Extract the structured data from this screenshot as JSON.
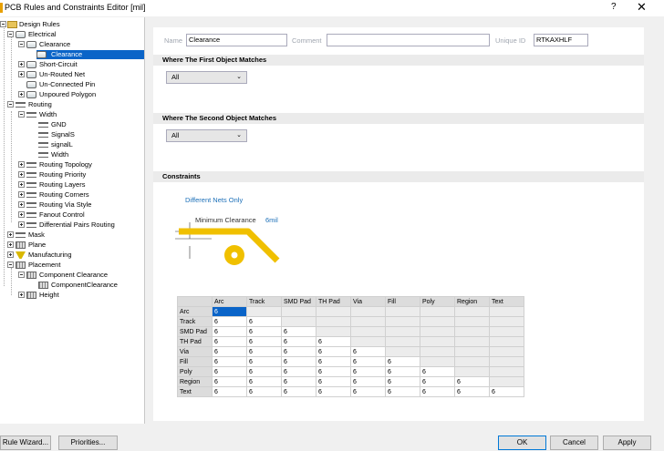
{
  "window": {
    "title": "PCB Rules and Constraints Editor [mil]",
    "help": "?",
    "close": "✕"
  },
  "tree": {
    "design_rules": "Design Rules",
    "electrical": "Electrical",
    "clearance_group": "Clearance",
    "clearance_rule": "Clearance",
    "short_circuit": "Short-Circuit",
    "unrouted_net": "Un-Routed Net",
    "unconnected_pin": "Un-Connected Pin",
    "unpoured_polygon": "Unpoured Polygon",
    "routing": "Routing",
    "width_group": "Width",
    "width_items": [
      "GND",
      "SignalS",
      "signalL",
      "Width"
    ],
    "routing_topology": "Routing Topology",
    "routing_priority": "Routing Priority",
    "routing_layers": "Routing Layers",
    "routing_corners": "Routing Corners",
    "routing_via_style": "Routing Via Style",
    "fanout_control": "Fanout Control",
    "diff_pairs": "Differential Pairs Routing",
    "mask": "Mask",
    "plane": "Plane",
    "manufacturing": "Manufacturing",
    "placement": "Placement",
    "component_clearance_group": "Component Clearance",
    "component_clearance_rule": "ComponentClearance",
    "height": "Height"
  },
  "form": {
    "name_label": "Name",
    "name_value": "Clearance",
    "comment_label": "Comment",
    "comment_value": "",
    "uid_label": "Unique ID",
    "uid_value": "RTKAXHLF"
  },
  "first_match": {
    "heading": "Where The First Object Matches",
    "value": "All"
  },
  "second_match": {
    "heading": "Where The Second Object Matches",
    "value": "All"
  },
  "constraints": {
    "heading": "Constraints",
    "net_scope": "Different Nets Only",
    "min_clearance_label": "Minimum Clearance",
    "min_clearance_value": "6mil",
    "columns": [
      "Arc",
      "Track",
      "SMD Pad",
      "TH Pad",
      "Via",
      "Fill",
      "Poly",
      "Region",
      "Text"
    ],
    "rows": [
      {
        "label": "Arc",
        "values": [
          "6"
        ]
      },
      {
        "label": "Track",
        "values": [
          "6",
          "6"
        ]
      },
      {
        "label": "SMD Pad",
        "values": [
          "6",
          "6",
          "6"
        ]
      },
      {
        "label": "TH Pad",
        "values": [
          "6",
          "6",
          "6",
          "6"
        ]
      },
      {
        "label": "Via",
        "values": [
          "6",
          "6",
          "6",
          "6",
          "6"
        ]
      },
      {
        "label": "Fill",
        "values": [
          "6",
          "6",
          "6",
          "6",
          "6",
          "6"
        ]
      },
      {
        "label": "Poly",
        "values": [
          "6",
          "6",
          "6",
          "6",
          "6",
          "6",
          "6"
        ]
      },
      {
        "label": "Region",
        "values": [
          "6",
          "6",
          "6",
          "6",
          "6",
          "6",
          "6",
          "6"
        ]
      },
      {
        "label": "Text",
        "values": [
          "6",
          "6",
          "6",
          "6",
          "6",
          "6",
          "6",
          "6",
          "6"
        ]
      }
    ]
  },
  "buttons": {
    "rule_wizard": "Rule Wizard...",
    "priorities": "Priorities...",
    "ok": "OK",
    "cancel": "Cancel",
    "apply": "Apply"
  },
  "colors": {
    "selection": "#0a64c8",
    "trace": "#f0c000",
    "accent_blue": "#1b6fb8"
  }
}
